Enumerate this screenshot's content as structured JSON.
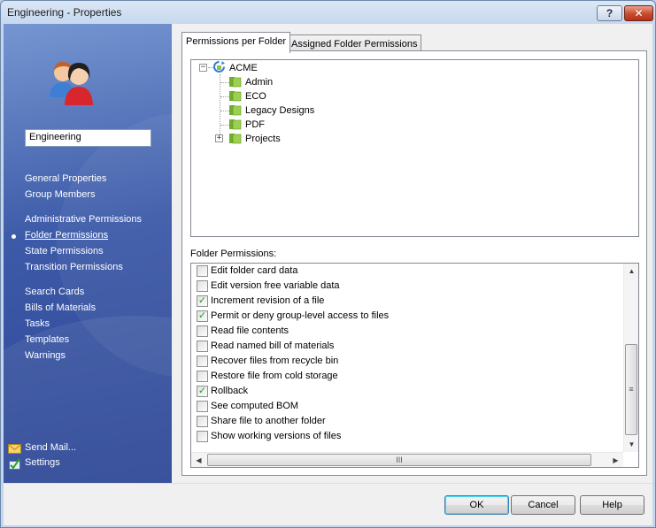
{
  "window": {
    "title": "Engineering - Properties",
    "help_glyph": "?",
    "close_glyph": "✕"
  },
  "sidebar": {
    "icon": "user-group-icon",
    "group_name": "Engineering",
    "nav": [
      {
        "label": "General Properties",
        "active": false
      },
      {
        "label": "Group Members",
        "active": false
      },
      {
        "label": "Administrative Permissions",
        "active": false
      },
      {
        "label": "Folder Permissions",
        "active": true
      },
      {
        "label": "State Permissions",
        "active": false
      },
      {
        "label": "Transition Permissions",
        "active": false
      },
      {
        "label": "Search Cards",
        "active": false
      },
      {
        "label": "Bills of Materials",
        "active": false
      },
      {
        "label": "Tasks",
        "active": false
      },
      {
        "label": "Templates",
        "active": false
      },
      {
        "label": "Warnings",
        "active": false
      }
    ],
    "footer": [
      {
        "label": "Send Mail...",
        "icon": "envelope-icon"
      },
      {
        "label": "Settings",
        "icon": "settings-checklist-icon"
      }
    ]
  },
  "tabs": [
    {
      "label": "Permissions per Folder",
      "active": true
    },
    {
      "label": "Assigned Folder Permissions",
      "active": false
    }
  ],
  "tree": {
    "root": {
      "label": "ACME",
      "icon": "vault-refresh-icon",
      "expanded": true
    },
    "children": [
      {
        "label": "Admin",
        "icon": "folder-icon",
        "has_children": false
      },
      {
        "label": "ECO",
        "icon": "folder-icon",
        "has_children": false
      },
      {
        "label": "Legacy Designs",
        "icon": "folder-icon",
        "has_children": false
      },
      {
        "label": "PDF",
        "icon": "folder-icon",
        "has_children": false
      },
      {
        "label": "Projects",
        "icon": "folder-icon",
        "has_children": true
      }
    ],
    "expanded_glyph": "−",
    "collapsed_glyph": "+"
  },
  "permissions": {
    "label": "Folder Permissions:",
    "check_glyph": "✓",
    "items": [
      {
        "label": "Edit folder card data",
        "checked": false
      },
      {
        "label": "Edit version free variable data",
        "checked": false
      },
      {
        "label": "Increment revision of a file",
        "checked": true
      },
      {
        "label": "Permit or deny group-level access to files",
        "checked": true
      },
      {
        "label": "Read file contents",
        "checked": false
      },
      {
        "label": "Read named bill of materials",
        "checked": false
      },
      {
        "label": "Recover files from recycle bin",
        "checked": false
      },
      {
        "label": "Restore file from cold storage",
        "checked": false
      },
      {
        "label": "Rollback",
        "checked": true
      },
      {
        "label": "See computed BOM",
        "checked": false
      },
      {
        "label": "Share file to another folder",
        "checked": false
      },
      {
        "label": "Show working versions of files",
        "checked": false
      }
    ],
    "scroll": {
      "up": "▲",
      "down": "▼",
      "left": "◀",
      "right": "▶",
      "grip_v": "≡",
      "grip_h": "III"
    }
  },
  "buttons": {
    "ok": "OK",
    "cancel": "Cancel",
    "help": "Help"
  },
  "colors": {
    "sidebar_top": "#7596d1",
    "sidebar_bottom": "#2b4594",
    "folder_green": "#8bc34a",
    "check_green": "#21a121"
  }
}
